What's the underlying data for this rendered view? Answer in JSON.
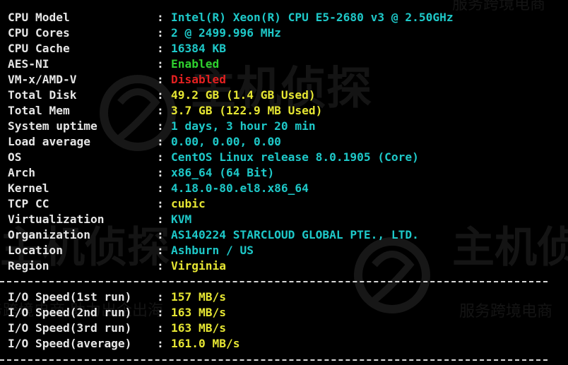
{
  "info_rows": [
    {
      "label": "CPU Model",
      "sep": ":",
      "value": "Intel(R) Xeon(R) CPU E5-2680 v3 @ 2.50GHz",
      "color": "#1ec8c8"
    },
    {
      "label": "CPU Cores",
      "sep": ":",
      "value": "2 @ 2499.996 MHz",
      "color": "#1ec8c8"
    },
    {
      "label": "CPU Cache",
      "sep": ":",
      "value": "16384 KB",
      "color": "#1ec8c8"
    },
    {
      "label": "AES-NI",
      "sep": ":",
      "value": "Enabled",
      "color": "#2fd12f"
    },
    {
      "label": "VM-x/AMD-V",
      "sep": ":",
      "value": "Disabled",
      "color": "#e32020"
    },
    {
      "label": "Total Disk",
      "sep": ":",
      "value": "49.2 GB (1.4 GB Used)",
      "color": "#e6e633"
    },
    {
      "label": "Total Mem",
      "sep": ":",
      "value": "3.7 GB (122.9 MB Used)",
      "color": "#e6e633"
    },
    {
      "label": "System uptime",
      "sep": ":",
      "value": "1 days, 3 hour 20 min",
      "color": "#1ec8c8"
    },
    {
      "label": "Load average",
      "sep": ":",
      "value": "0.00, 0.00, 0.00",
      "color": "#1ec8c8"
    },
    {
      "label": "OS",
      "sep": ":",
      "value": "CentOS Linux release 8.0.1905 (Core)",
      "color": "#1ec8c8"
    },
    {
      "label": "Arch",
      "sep": ":",
      "value": "x86_64 (64 Bit)",
      "color": "#1ec8c8"
    },
    {
      "label": "Kernel",
      "sep": ":",
      "value": "4.18.0-80.el8.x86_64",
      "color": "#1ec8c8"
    },
    {
      "label": "TCP CC",
      "sep": ":",
      "value": "cubic",
      "color": "#e6e633"
    },
    {
      "label": "Virtualization",
      "sep": ":",
      "value": "KVM",
      "color": "#1ec8c8"
    },
    {
      "label": "Organization",
      "sep": ":",
      "value": "AS140224 STARCLOUD GLOBAL PTE., LTD.",
      "color": "#1ec8c8"
    },
    {
      "label": "Location",
      "sep": ":",
      "value": "Ashburn / US",
      "color": "#1ec8c8"
    },
    {
      "label": "Region",
      "sep": ":",
      "value": "Virginia",
      "color": "#e6e633"
    }
  ],
  "io_rows": [
    {
      "label": "I/O Speed(1st run)",
      "sep": ":",
      "value": "157 MB/s",
      "color": "#e6e633"
    },
    {
      "label": "I/O Speed(2nd run)",
      "sep": ":",
      "value": "163 MB/s",
      "color": "#e6e633"
    },
    {
      "label": "I/O Speed(3rd run)",
      "sep": ":",
      "value": "163 MB/s",
      "color": "#e6e633"
    },
    {
      "label": "I/O Speed(average)",
      "sep": ":",
      "value": "161.0 MB/s",
      "color": "#e6e633"
    }
  ],
  "watermark": {
    "brand": "主机侦探",
    "slogan": "服务跨境电商 助力出企出海",
    "slogan_short": "服务跨境电商"
  },
  "colors": {
    "background": "#000000",
    "label": "#e6e6e6",
    "cyan": "#1ec8c8",
    "green": "#2fd12f",
    "red": "#e32020",
    "yellow": "#e6e633",
    "divider": "#d9d9d9"
  }
}
